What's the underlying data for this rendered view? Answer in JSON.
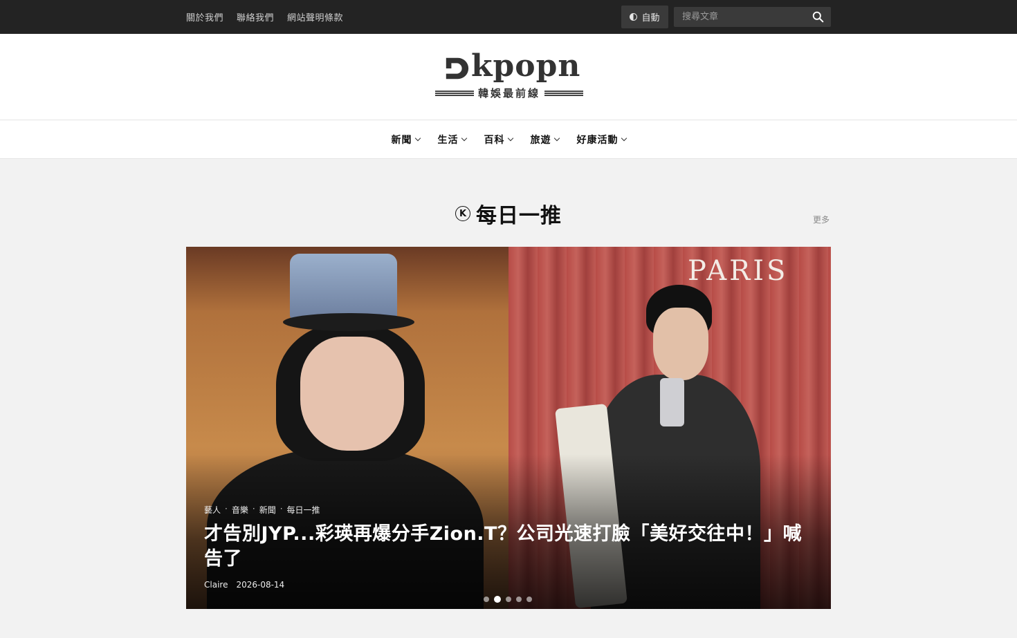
{
  "topbar": {
    "links": [
      "關於我們",
      "聯絡我們",
      "網站聲明條款"
    ],
    "mode_label": "自動",
    "search_placeholder": "搜尋文章"
  },
  "logo": {
    "wordmark": "kpopn",
    "tagline": "韓娛最前線"
  },
  "nav": {
    "items": [
      "新聞",
      "生活",
      "百科",
      "旅遊",
      "好康活動"
    ]
  },
  "section": {
    "badge": "K",
    "title": "每日一推",
    "more_label": "更多"
  },
  "featured": {
    "image_text": "PARIS",
    "categories": [
      "藝人",
      "音樂",
      "新聞",
      "每日一推"
    ],
    "separator": "·",
    "headline": "才告別JYP...彩瑛再爆分手Zion.T？公司光速打臉「美好交往中！」喊告了",
    "author": "Claire",
    "date": "2026-08-14",
    "slide_count": 5,
    "active_slide": 2
  },
  "colors": {
    "topbar_bg": "#232323",
    "page_bg": "#f2f2f2",
    "text": "#111111"
  }
}
